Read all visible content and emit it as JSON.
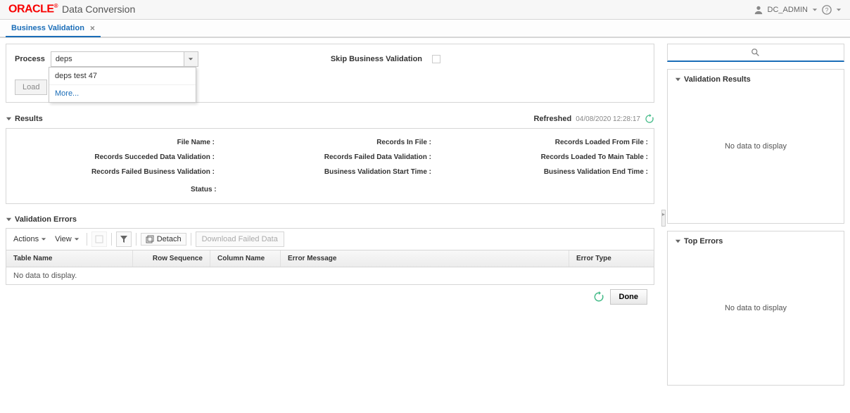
{
  "header": {
    "logo_text": "ORACLE",
    "app_title": "Data Conversion",
    "user_name": "DC_ADMIN"
  },
  "tabs": [
    {
      "label": "Business Validation"
    }
  ],
  "process": {
    "label": "Process",
    "selected": "deps",
    "options": [
      "deps test 47",
      "More..."
    ],
    "skip_label": "Skip Business Validation",
    "load_label": "Load"
  },
  "results": {
    "title": "Results",
    "refreshed_label": "Refreshed",
    "refreshed_time": "04/08/2020 12:28:17",
    "labels": {
      "file_name": "File Name :",
      "records_in_file": "Records In File :",
      "records_loaded_from_file": "Records Loaded From File :",
      "records_succeeded_dv": "Records Succeded Data Validation :",
      "records_failed_dv": "Records Failed Data Validation :",
      "records_loaded_main": "Records Loaded To Main Table :",
      "records_failed_bv": "Records Failed Business Validation :",
      "bv_start": "Business Validation Start Time :",
      "bv_end": "Business Validation End Time :",
      "status": "Status :"
    }
  },
  "validation_errors": {
    "title": "Validation Errors",
    "actions_label": "Actions",
    "view_label": "View",
    "detach_label": "Detach",
    "download_label": "Download Failed Data",
    "columns": {
      "table_name": "Table Name",
      "row_sequence": "Row Sequence",
      "column_name": "Column Name",
      "error_message": "Error Message",
      "error_type": "Error Type"
    },
    "no_data": "No data to display."
  },
  "right": {
    "validation_results": {
      "title": "Validation Results",
      "no_data": "No data to display"
    },
    "top_errors": {
      "title": "Top Errors",
      "no_data": "No data to display"
    }
  },
  "footer": {
    "done_label": "Done"
  }
}
